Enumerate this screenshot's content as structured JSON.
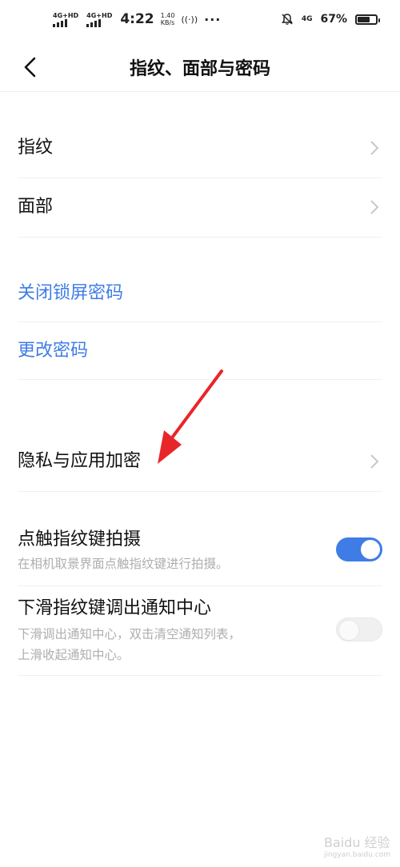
{
  "status_bar": {
    "network_1": "4G+HD",
    "network_2": "4G+HD",
    "time": "4:22",
    "speed_value": "1.40",
    "speed_unit": "KB/s",
    "lte": "4G",
    "battery_percent": "67%",
    "battery_level": 0.67
  },
  "header": {
    "title": "指纹、面部与密码"
  },
  "items": {
    "fingerprint": "指纹",
    "face": "面部",
    "close_lock_password": "关闭锁屏密码",
    "change_password": "更改密码",
    "privacy_encryption": "隐私与应用加密",
    "touch_shoot": {
      "label": "点触指纹键拍摄",
      "desc": "在相机取景界面点触指纹键进行拍摄。",
      "enabled": true
    },
    "slide_notify": {
      "label": "下滑指纹键调出通知中心",
      "desc_line1": "下滑调出通知中心，双击清空通知列表，",
      "desc_line2": "上滑收起通知中心。",
      "enabled": false
    }
  },
  "colors": {
    "accent": "#3f7ce5",
    "annotation_arrow": "#e8262a"
  },
  "watermark": {
    "brand": "Baidu 经验",
    "url": "jingyan.baidu.com"
  }
}
